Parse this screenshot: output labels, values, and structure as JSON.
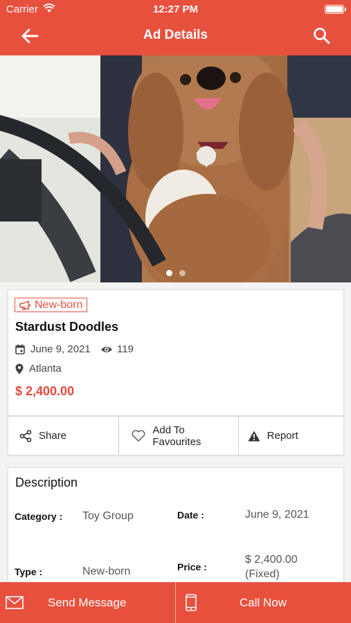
{
  "status": {
    "carrier": "Carrier",
    "time": "12:27 PM"
  },
  "nav": {
    "title": "Ad Details",
    "back_icon": "arrow-left-icon",
    "search_icon": "search-icon"
  },
  "carousel": {
    "slides": 2,
    "active": 0
  },
  "ad": {
    "badge": "New-born",
    "title": "Stardust Doodles",
    "date": "June 9, 2021",
    "views": "119",
    "location": "Atlanta",
    "price": "$ 2,400.00"
  },
  "actions": {
    "share": "Share",
    "favourite": "Add To Favourites",
    "report": "Report"
  },
  "description": {
    "heading": "Description",
    "category_label": "Category :",
    "category_value": "Toy Group",
    "date_label": "Date :",
    "date_value": "June 9, 2021",
    "type_label": "Type :",
    "type_value": "New-born",
    "price_label": "Price :",
    "price_value": "$ 2,400.00",
    "price_note": "(Fixed)"
  },
  "bottom": {
    "message": "Send Message",
    "call": "Call Now"
  },
  "colors": {
    "accent": "#e8503e",
    "price": "#e34a3b"
  }
}
